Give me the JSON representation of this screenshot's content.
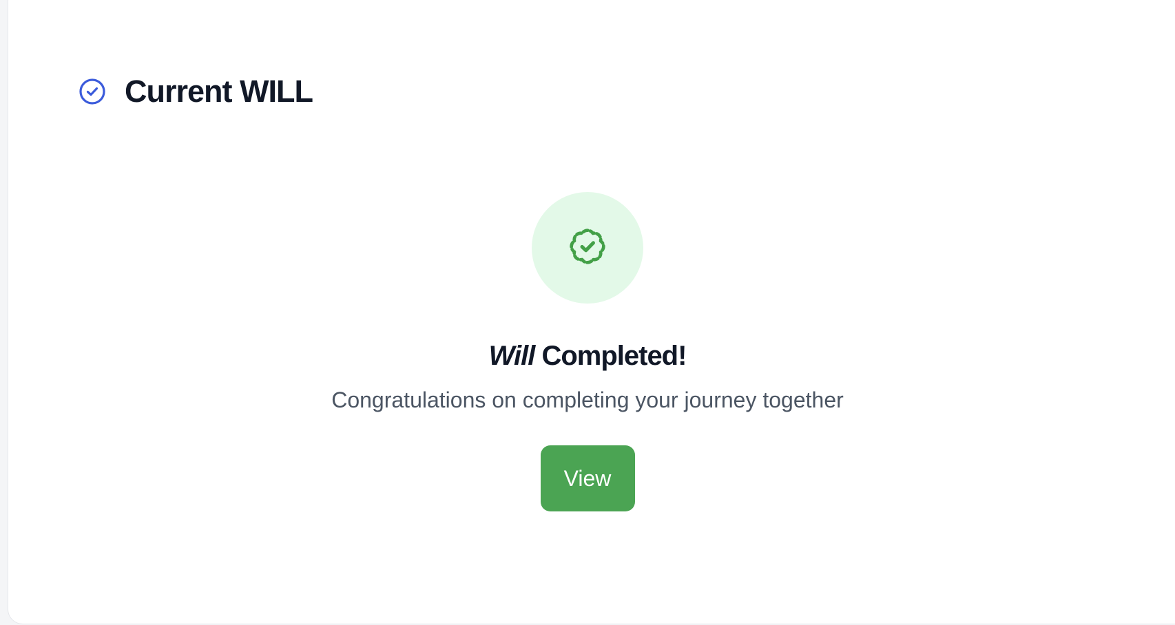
{
  "header": {
    "title": "Current WILL",
    "icon": "check-circle-icon",
    "icon_color": "#3b5bdb"
  },
  "status": {
    "badge_icon": "badge-check-icon",
    "badge_color": "#43a047",
    "badge_background": "#e3f9e8",
    "title_emphasis": "Will",
    "title_rest": "Completed!",
    "subtitle": "Congratulations on completing your journey together"
  },
  "actions": {
    "view_label": "View",
    "view_color": "#4ba453"
  }
}
